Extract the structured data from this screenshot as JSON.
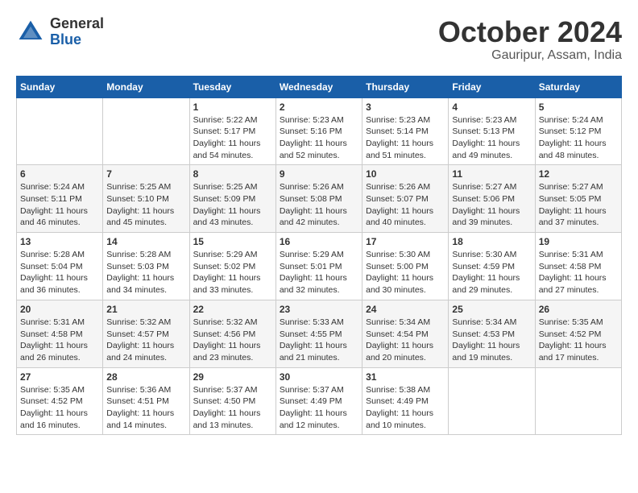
{
  "header": {
    "logo_general": "General",
    "logo_blue": "Blue",
    "month_title": "October 2024",
    "subtitle": "Gauripur, Assam, India"
  },
  "weekdays": [
    "Sunday",
    "Monday",
    "Tuesday",
    "Wednesday",
    "Thursday",
    "Friday",
    "Saturday"
  ],
  "weeks": [
    [
      {
        "day": "",
        "info": ""
      },
      {
        "day": "",
        "info": ""
      },
      {
        "day": "1",
        "info": "Sunrise: 5:22 AM\nSunset: 5:17 PM\nDaylight: 11 hours and 54 minutes."
      },
      {
        "day": "2",
        "info": "Sunrise: 5:23 AM\nSunset: 5:16 PM\nDaylight: 11 hours and 52 minutes."
      },
      {
        "day": "3",
        "info": "Sunrise: 5:23 AM\nSunset: 5:14 PM\nDaylight: 11 hours and 51 minutes."
      },
      {
        "day": "4",
        "info": "Sunrise: 5:23 AM\nSunset: 5:13 PM\nDaylight: 11 hours and 49 minutes."
      },
      {
        "day": "5",
        "info": "Sunrise: 5:24 AM\nSunset: 5:12 PM\nDaylight: 11 hours and 48 minutes."
      }
    ],
    [
      {
        "day": "6",
        "info": "Sunrise: 5:24 AM\nSunset: 5:11 PM\nDaylight: 11 hours and 46 minutes."
      },
      {
        "day": "7",
        "info": "Sunrise: 5:25 AM\nSunset: 5:10 PM\nDaylight: 11 hours and 45 minutes."
      },
      {
        "day": "8",
        "info": "Sunrise: 5:25 AM\nSunset: 5:09 PM\nDaylight: 11 hours and 43 minutes."
      },
      {
        "day": "9",
        "info": "Sunrise: 5:26 AM\nSunset: 5:08 PM\nDaylight: 11 hours and 42 minutes."
      },
      {
        "day": "10",
        "info": "Sunrise: 5:26 AM\nSunset: 5:07 PM\nDaylight: 11 hours and 40 minutes."
      },
      {
        "day": "11",
        "info": "Sunrise: 5:27 AM\nSunset: 5:06 PM\nDaylight: 11 hours and 39 minutes."
      },
      {
        "day": "12",
        "info": "Sunrise: 5:27 AM\nSunset: 5:05 PM\nDaylight: 11 hours and 37 minutes."
      }
    ],
    [
      {
        "day": "13",
        "info": "Sunrise: 5:28 AM\nSunset: 5:04 PM\nDaylight: 11 hours and 36 minutes."
      },
      {
        "day": "14",
        "info": "Sunrise: 5:28 AM\nSunset: 5:03 PM\nDaylight: 11 hours and 34 minutes."
      },
      {
        "day": "15",
        "info": "Sunrise: 5:29 AM\nSunset: 5:02 PM\nDaylight: 11 hours and 33 minutes."
      },
      {
        "day": "16",
        "info": "Sunrise: 5:29 AM\nSunset: 5:01 PM\nDaylight: 11 hours and 32 minutes."
      },
      {
        "day": "17",
        "info": "Sunrise: 5:30 AM\nSunset: 5:00 PM\nDaylight: 11 hours and 30 minutes."
      },
      {
        "day": "18",
        "info": "Sunrise: 5:30 AM\nSunset: 4:59 PM\nDaylight: 11 hours and 29 minutes."
      },
      {
        "day": "19",
        "info": "Sunrise: 5:31 AM\nSunset: 4:58 PM\nDaylight: 11 hours and 27 minutes."
      }
    ],
    [
      {
        "day": "20",
        "info": "Sunrise: 5:31 AM\nSunset: 4:58 PM\nDaylight: 11 hours and 26 minutes."
      },
      {
        "day": "21",
        "info": "Sunrise: 5:32 AM\nSunset: 4:57 PM\nDaylight: 11 hours and 24 minutes."
      },
      {
        "day": "22",
        "info": "Sunrise: 5:32 AM\nSunset: 4:56 PM\nDaylight: 11 hours and 23 minutes."
      },
      {
        "day": "23",
        "info": "Sunrise: 5:33 AM\nSunset: 4:55 PM\nDaylight: 11 hours and 21 minutes."
      },
      {
        "day": "24",
        "info": "Sunrise: 5:34 AM\nSunset: 4:54 PM\nDaylight: 11 hours and 20 minutes."
      },
      {
        "day": "25",
        "info": "Sunrise: 5:34 AM\nSunset: 4:53 PM\nDaylight: 11 hours and 19 minutes."
      },
      {
        "day": "26",
        "info": "Sunrise: 5:35 AM\nSunset: 4:52 PM\nDaylight: 11 hours and 17 minutes."
      }
    ],
    [
      {
        "day": "27",
        "info": "Sunrise: 5:35 AM\nSunset: 4:52 PM\nDaylight: 11 hours and 16 minutes."
      },
      {
        "day": "28",
        "info": "Sunrise: 5:36 AM\nSunset: 4:51 PM\nDaylight: 11 hours and 14 minutes."
      },
      {
        "day": "29",
        "info": "Sunrise: 5:37 AM\nSunset: 4:50 PM\nDaylight: 11 hours and 13 minutes."
      },
      {
        "day": "30",
        "info": "Sunrise: 5:37 AM\nSunset: 4:49 PM\nDaylight: 11 hours and 12 minutes."
      },
      {
        "day": "31",
        "info": "Sunrise: 5:38 AM\nSunset: 4:49 PM\nDaylight: 11 hours and 10 minutes."
      },
      {
        "day": "",
        "info": ""
      },
      {
        "day": "",
        "info": ""
      }
    ]
  ]
}
